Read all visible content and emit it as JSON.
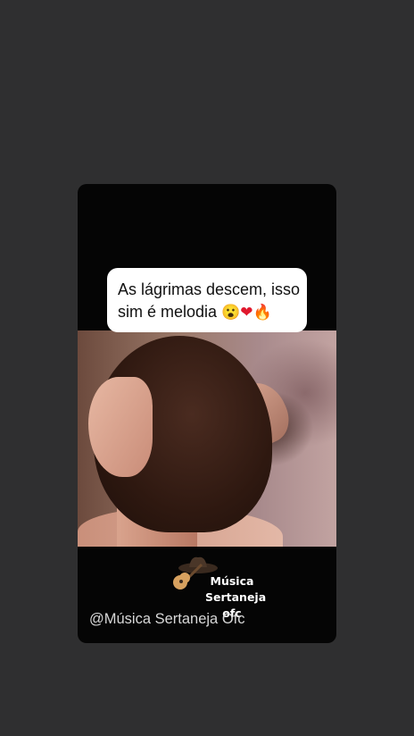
{
  "story": {
    "caption": {
      "line1": "As lágrimas descem, isso",
      "line2": "sim é melodia",
      "emojis": [
        "😮",
        "❤",
        "🔥"
      ]
    },
    "logo": {
      "line1": "Música",
      "line2": "Sertaneja",
      "line3": "ofc"
    },
    "watermark_handle": "@Música Sertaneja Ofc"
  },
  "colors": {
    "background": "#2f2f30",
    "card": "#050505",
    "caption_bg": "#ffffff"
  }
}
